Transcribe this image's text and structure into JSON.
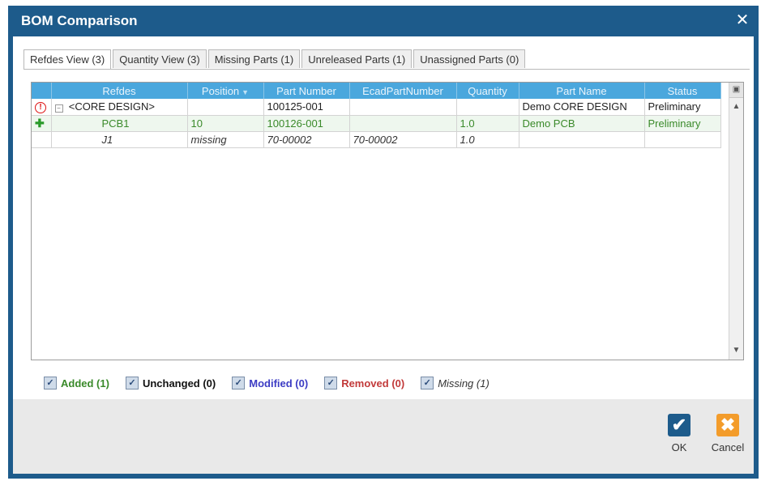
{
  "window": {
    "title": "BOM Comparison",
    "close_glyph": "✕"
  },
  "tabs": [
    {
      "label": "Refdes View (3)",
      "active": true
    },
    {
      "label": "Quantity View (3)",
      "active": false
    },
    {
      "label": "Missing Parts (1)",
      "active": false
    },
    {
      "label": "Unreleased Parts (1)",
      "active": false
    },
    {
      "label": "Unassigned Parts (0)",
      "active": false
    }
  ],
  "table": {
    "columns": [
      "Refdes",
      "Position",
      "Part Number",
      "EcadPartNumber",
      "Quantity",
      "Part Name",
      "Status"
    ],
    "rows": [
      {
        "status_icon": "error-icon",
        "refdes": "<CORE DESIGN>",
        "position": "",
        "part_number": "100125-001",
        "ecad_part_number": "",
        "quantity": "",
        "part_name": "Demo CORE DESIGN",
        "status": "Preliminary"
      },
      {
        "status_icon": "add-icon",
        "refdes": "PCB1",
        "position": "10",
        "part_number": "100126-001",
        "ecad_part_number": "",
        "quantity": "1.0",
        "part_name": "Demo PCB",
        "status": "Preliminary"
      },
      {
        "status_icon": "",
        "refdes": "J1",
        "position": "missing",
        "part_number": "70-00002",
        "ecad_part_number": "70-00002",
        "quantity": "1.0",
        "part_name": "",
        "status": ""
      }
    ]
  },
  "filters": {
    "added": "Added (1)",
    "unchanged": "Unchanged (0)",
    "modified": "Modified (0)",
    "removed": "Removed (0)",
    "missing": "Missing (1)"
  },
  "buttons": {
    "ok": "OK",
    "cancel": "Cancel"
  },
  "colors": {
    "titlebar": "#1d5b8b",
    "header": "#4aa7dd",
    "added": "#3a8a2a",
    "modified": "#3c3cc4",
    "removed": "#c23a3a",
    "cancel": "#f39c2b"
  }
}
